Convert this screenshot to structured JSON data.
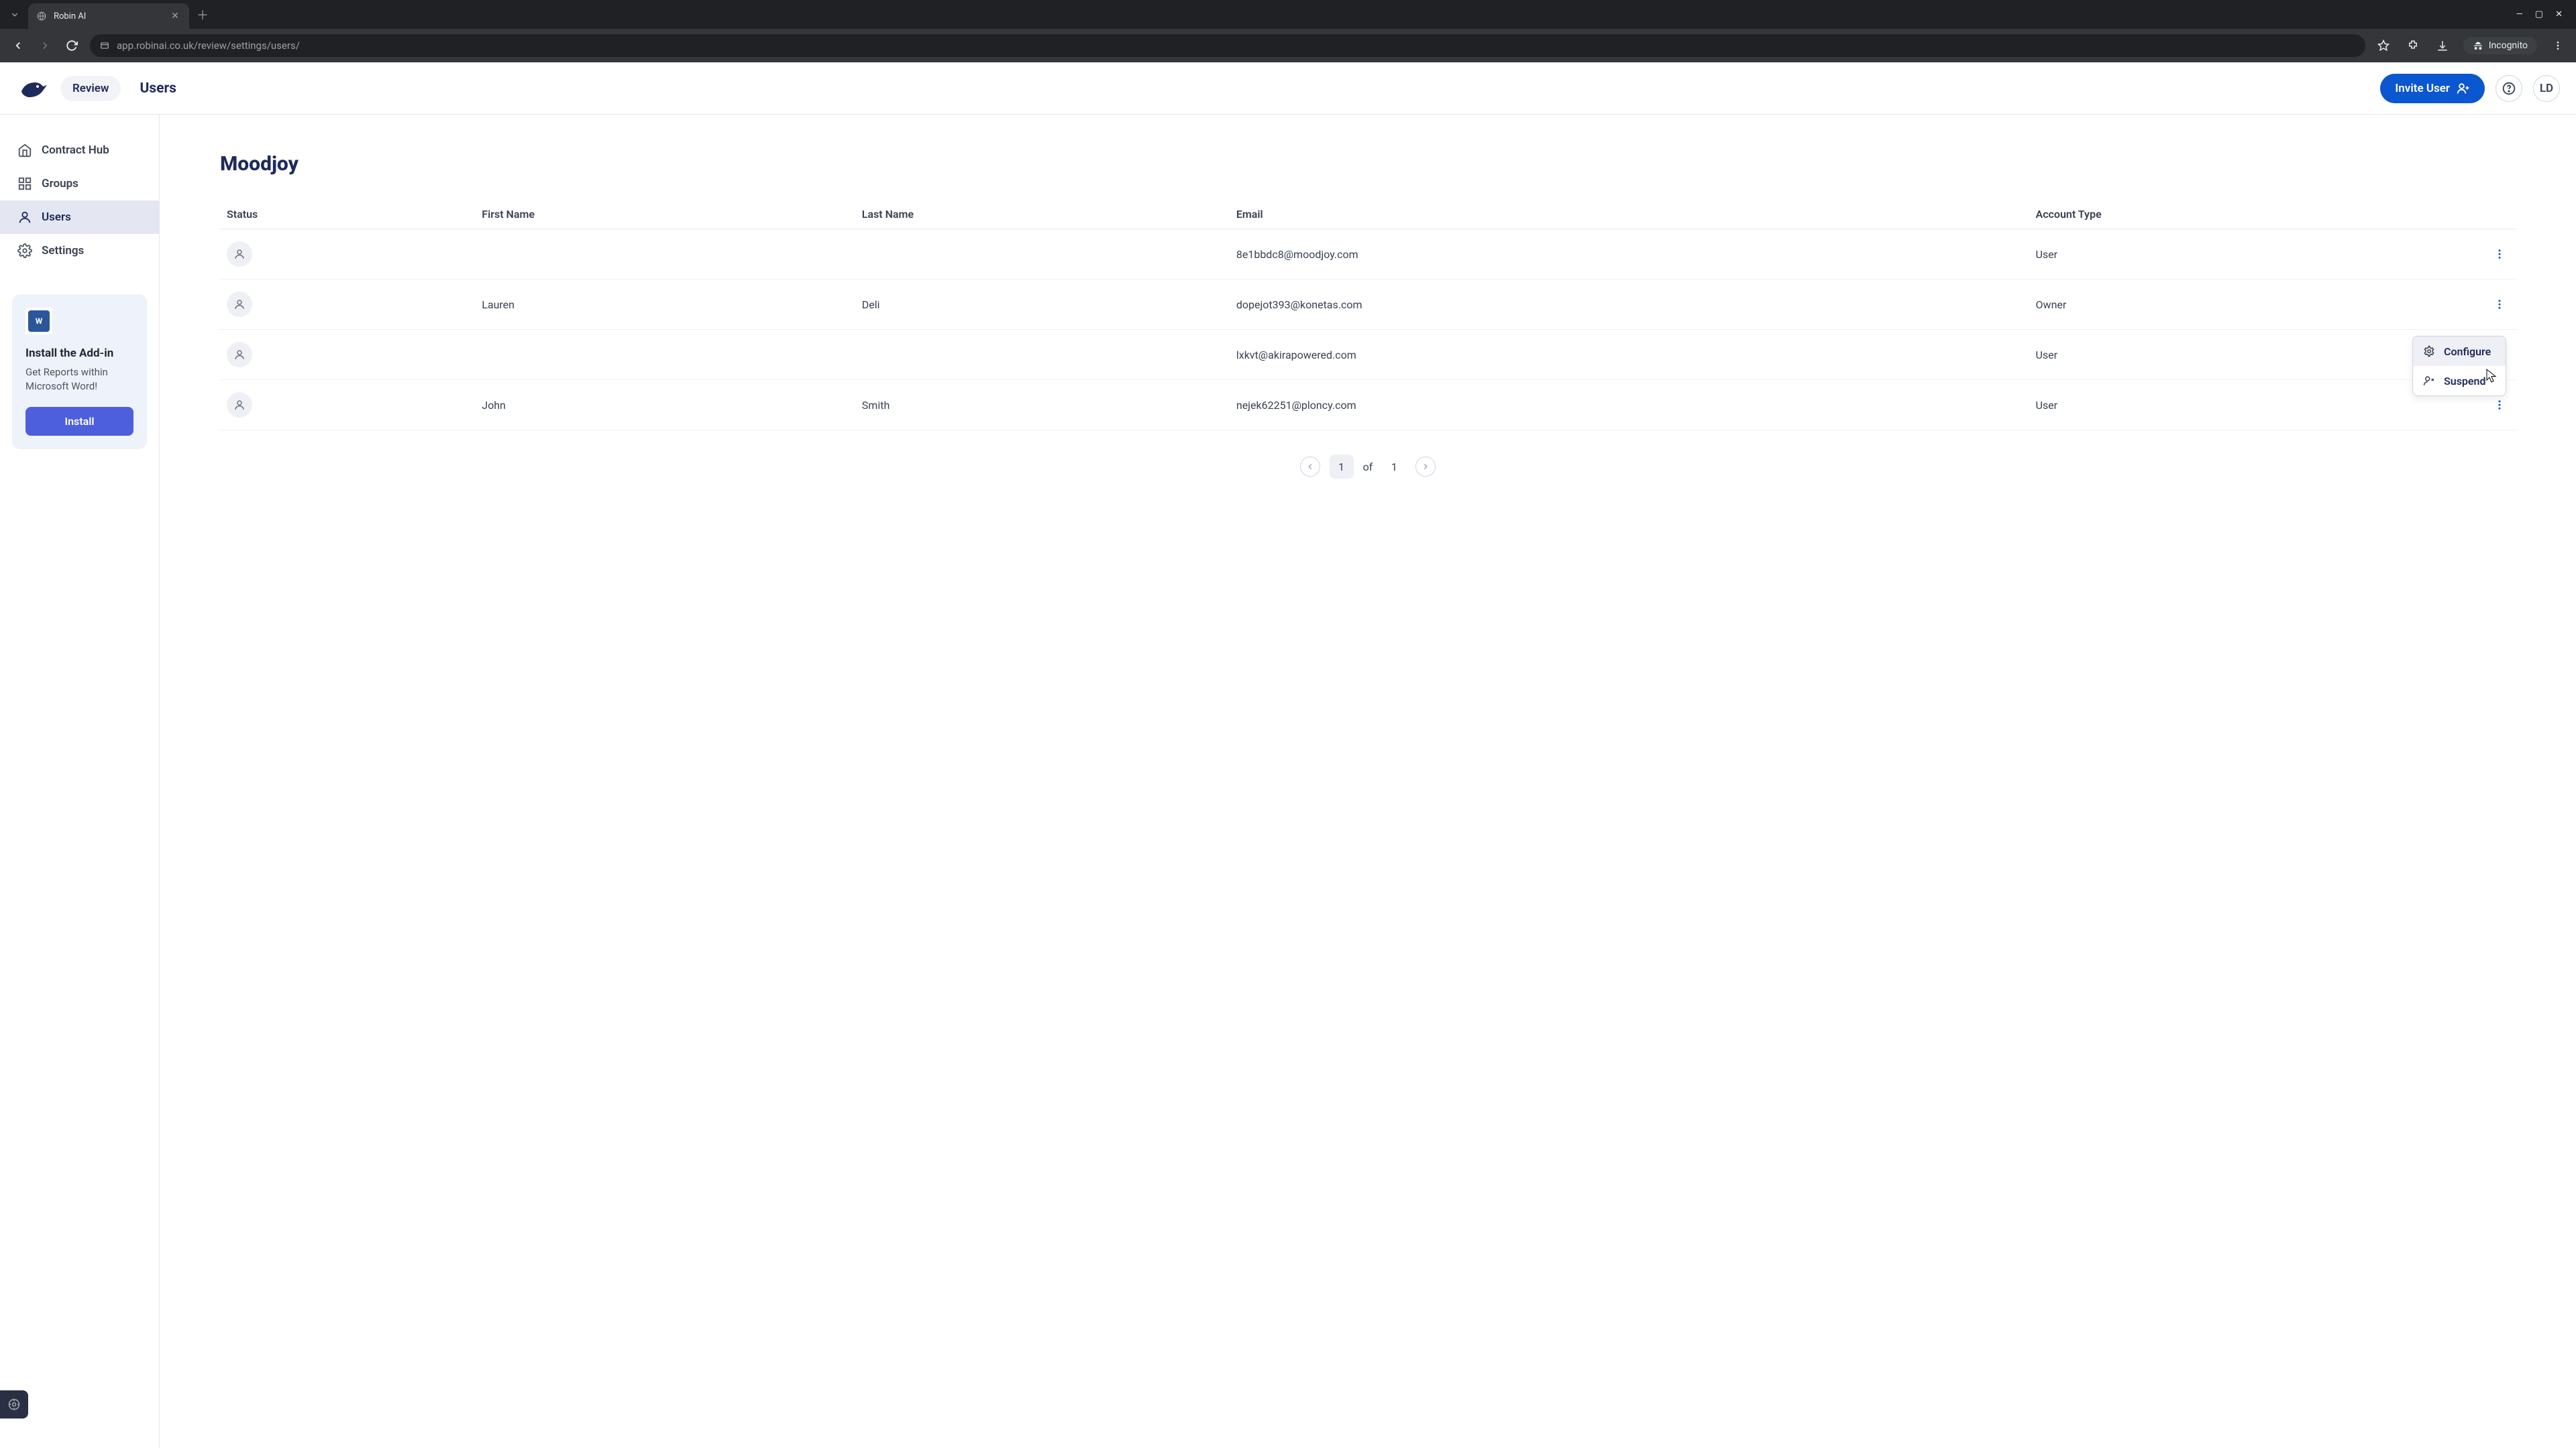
{
  "browser": {
    "tab_title": "Robin AI",
    "url": "app.robinai.co.uk/review/settings/users/",
    "incognito_label": "Incognito"
  },
  "header": {
    "review": "Review",
    "page_title": "Users",
    "invite_label": "Invite User",
    "avatar_initials": "LD"
  },
  "sidebar": {
    "items": [
      {
        "label": "Contract Hub"
      },
      {
        "label": "Groups"
      },
      {
        "label": "Users"
      },
      {
        "label": "Settings"
      }
    ],
    "addin_title": "Install the Add-in",
    "addin_desc": "Get Reports within Microsoft Word!",
    "install_label": "Install"
  },
  "main": {
    "org": "Moodjoy",
    "columns": {
      "status": "Status",
      "first_name": "First Name",
      "last_name": "Last Name",
      "email": "Email",
      "account_type": "Account Type"
    },
    "rows": [
      {
        "first": "",
        "last": "",
        "email": "8e1bbdc8@moodjoy.com",
        "type": "User"
      },
      {
        "first": "Lauren",
        "last": "Deli",
        "email": "dopejot393@konetas.com",
        "type": "Owner"
      },
      {
        "first": "",
        "last": "",
        "email": "lxkvt@akirapowered.com",
        "type": "User"
      },
      {
        "first": "John",
        "last": "Smith",
        "email": "nejek62251@ploncy.com",
        "type": "User"
      }
    ],
    "context_menu": {
      "configure": "Configure",
      "suspend": "Suspend"
    },
    "pagination": {
      "current": "1",
      "of": "of",
      "total": "1"
    }
  }
}
